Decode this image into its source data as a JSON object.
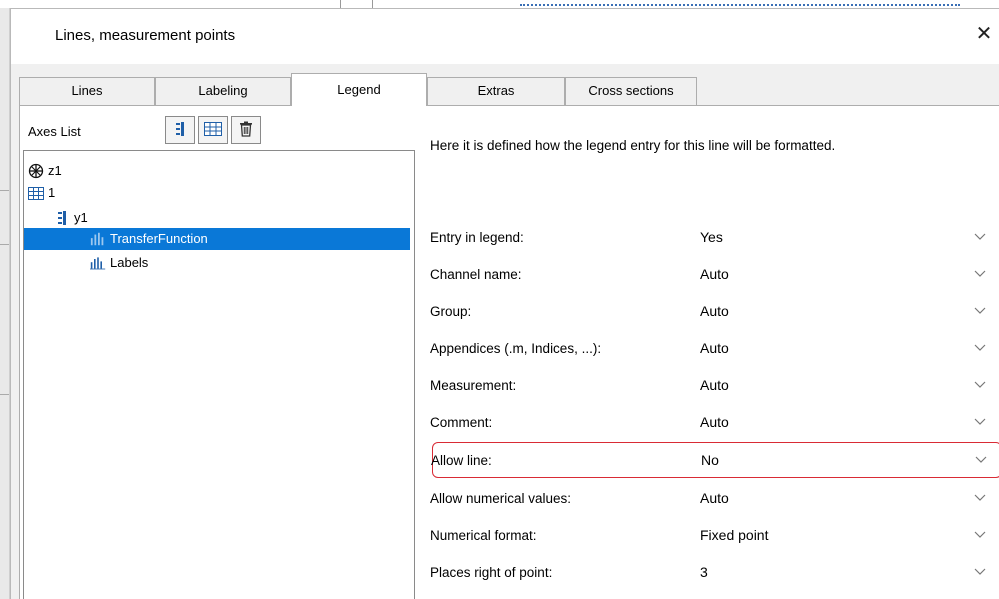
{
  "dialog": {
    "title": "Lines, measurement points",
    "close_glyph": "✕"
  },
  "tabs": [
    {
      "label": "Lines",
      "active": false
    },
    {
      "label": "Labeling",
      "active": false
    },
    {
      "label": "Legend",
      "active": true
    },
    {
      "label": "Extras",
      "active": false
    },
    {
      "label": "Cross sections",
      "active": false
    }
  ],
  "left_pane": {
    "axes_list_label": "Axes List",
    "toolbar": [
      {
        "icon": "y-axis-icon"
      },
      {
        "icon": "table-icon"
      },
      {
        "icon": "trash-icon"
      }
    ],
    "tree": [
      {
        "label": "z1",
        "icon": "globe-axis-icon",
        "selected": false
      },
      {
        "label": "1",
        "icon": "table-icon",
        "selected": false
      },
      {
        "label": "y1",
        "icon": "y-axis-icon",
        "selected": false
      },
      {
        "label": "TransferFunction",
        "icon": "bar-channel-icon",
        "selected": true
      },
      {
        "label": "Labels",
        "icon": "bar-channel-icon",
        "selected": false
      }
    ]
  },
  "right_pane": {
    "description": "Here it is defined how the legend entry for this line will be formatted.",
    "properties": [
      {
        "label": "Entry in legend:",
        "value": "Yes"
      },
      {
        "label": "Channel name:",
        "value": "Auto"
      },
      {
        "label": "Group:",
        "value": "Auto"
      },
      {
        "label": "Appendices (.m, Indices, ...):",
        "value": "Auto"
      },
      {
        "label": "Measurement:",
        "value": "Auto"
      },
      {
        "label": "Comment:",
        "value": "Auto"
      },
      {
        "label": "Allow line:",
        "value": "No",
        "highlighted": true
      },
      {
        "label": "Allow numerical values:",
        "value": "Auto"
      },
      {
        "label": "Numerical format:",
        "value": "Fixed point"
      },
      {
        "label": "Places right of point:",
        "value": "3"
      }
    ]
  },
  "colors": {
    "selection": "#0a78d7",
    "highlight_border": "#d92b35",
    "icon_blue": "#1f5fa8"
  }
}
